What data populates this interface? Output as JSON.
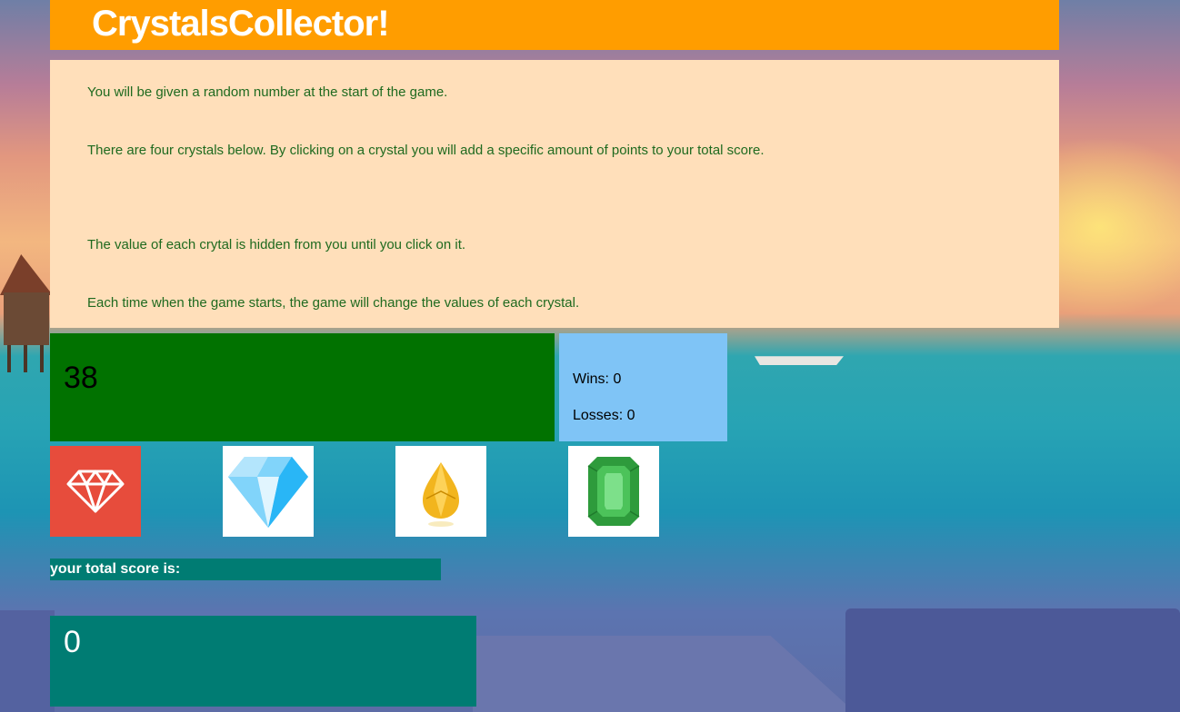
{
  "header": {
    "title": "CrystalsCollector!"
  },
  "instructions": [
    "You will be given a random number at the start of the game.",
    "There are four crystals below. By clicking on a crystal you will add a specific amount of points to your total score.",
    "The value of each crytal is hidden from you until you click on it.",
    "Each time when the game starts, the game will change the values of each crystal."
  ],
  "target_number": "38",
  "record": {
    "wins": "Wins: 0",
    "losses": "Losses: 0"
  },
  "crystals": [
    {
      "icon": "red-diamond-icon",
      "color": "#e74c3c"
    },
    {
      "icon": "blue-diamond-icon",
      "color": "#4fc3f7"
    },
    {
      "icon": "yellow-gem-icon",
      "color": "#f2b51e"
    },
    {
      "icon": "green-emerald-icon",
      "color": "#2e9b3c"
    }
  ],
  "score": {
    "label": "your total score is:",
    "value": "0"
  },
  "colors": {
    "header": "#ff9d00",
    "instructions_bg": "#ffdfba",
    "instructions_text": "#1f6a1f",
    "target_bg": "#017200",
    "record_bg": "#7fc4f6",
    "score_bg": "#007c73"
  }
}
